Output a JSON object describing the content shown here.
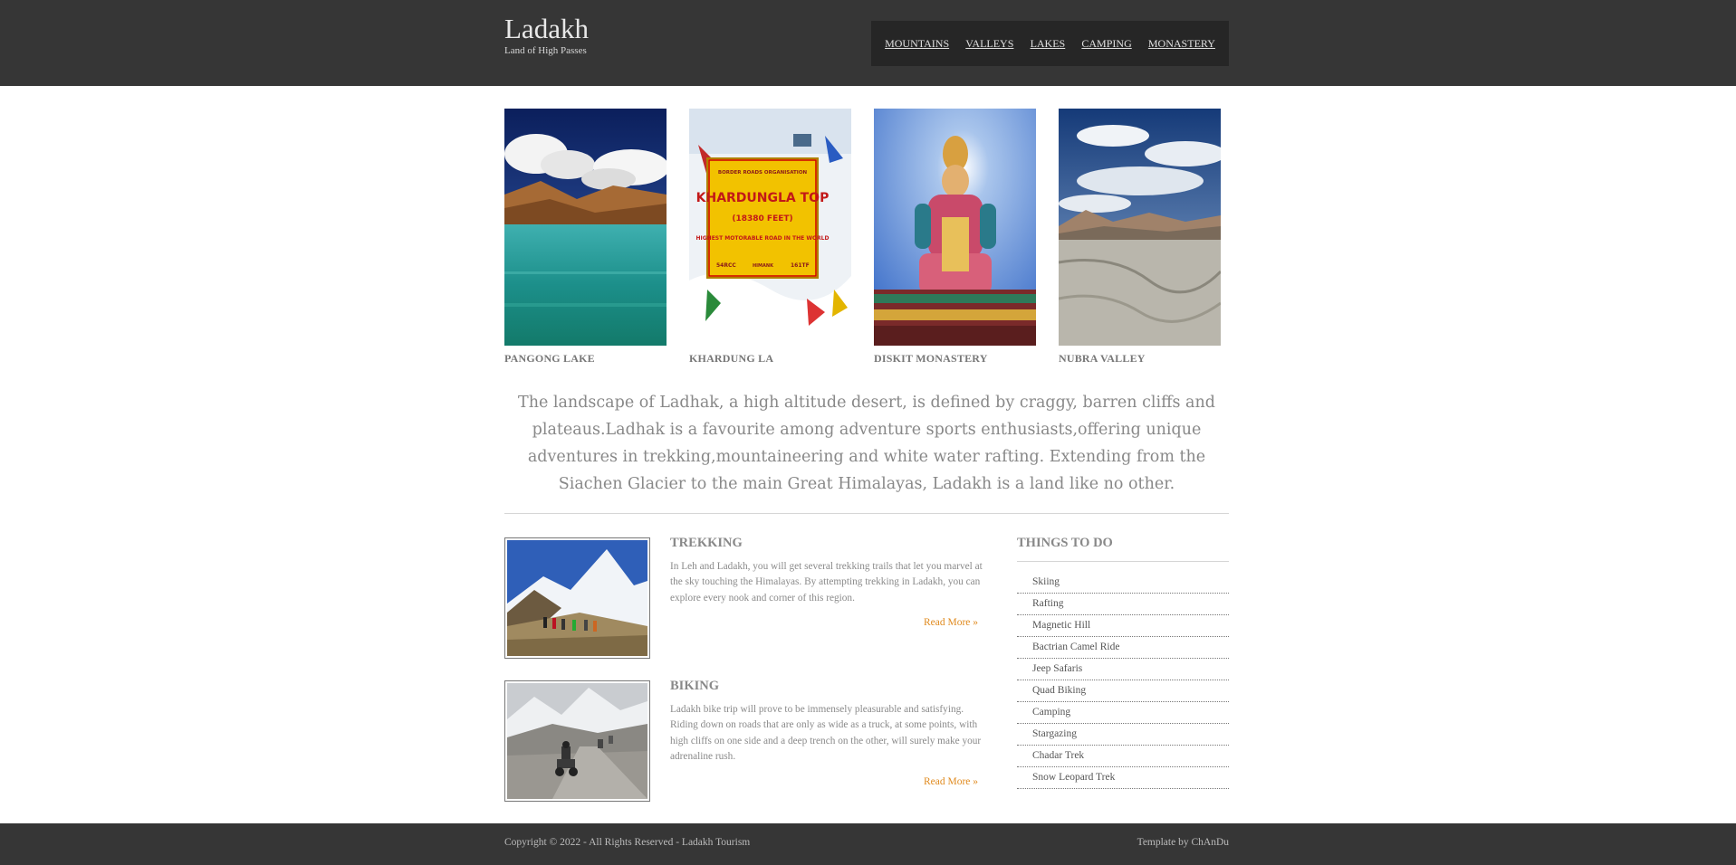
{
  "site": {
    "title": "Ladakh",
    "tagline": "Land of High Passes"
  },
  "nav": [
    "MOUNTAINS",
    "VALLEYS",
    "LAKES",
    "CAMPING",
    "MONASTERY"
  ],
  "gallery": [
    {
      "caption": "PANGONG LAKE"
    },
    {
      "caption": "KHARDUNG LA"
    },
    {
      "caption": "DISKIT MONASTERY"
    },
    {
      "caption": "NUBRA VALLEY"
    }
  ],
  "sign": {
    "org": "BORDER ROADS ORGANISATION",
    "title": "KHARDUNGLA TOP",
    "height": "(18380 FEET)",
    "subtitle": "HIGHEST MOTORABLE ROAD IN THE WORLD",
    "left": "54RCC",
    "mid": "HIMANK",
    "right": "161TF"
  },
  "intro": "The landscape of Ladhak, a high altitude desert, is defined by craggy, barren cliffs and plateaus.Ladhak is a favourite among adventure sports enthusiasts,offering unique adventures in trekking,mountaineering and white water rafting. Extending from the Siachen Glacier to the main Great Himalayas, Ladakh is a land like no other.",
  "features": [
    {
      "title": "TREKKING",
      "text": "In Leh and Ladakh, you will get several trekking trails that let you marvel at the sky touching the Himalayas. By attempting trekking in Ladakh, you can explore every nook and corner of this region.",
      "link": "Read More »"
    },
    {
      "title": "BIKING",
      "text": "Ladakh bike trip will prove to be immensely pleasurable and satisfying. Riding down on roads that are only as wide as a truck, at some points, with high cliffs on one side and a deep trench on the other, will surely make your adrenaline rush.",
      "link": "Read More »"
    }
  ],
  "sidebar": {
    "title": "THINGS TO DO",
    "items": [
      "Skiing",
      "Rafting",
      "Magnetic Hill",
      "Bactrian Camel Ride",
      "Jeep Safaris",
      "Quad Biking",
      "Camping",
      "Stargazing",
      "Chadar Trek",
      "Snow Leopard Trek"
    ]
  },
  "footer": {
    "copyright": "Copyright © 2022 - All Rights Reserved - Ladakh Tourism",
    "credit": "Template by ChAnDu"
  },
  "colors": {
    "header_bg": "#363636",
    "nav_bg": "#262626",
    "link_accent": "#e08a1e",
    "text": "#888888"
  }
}
